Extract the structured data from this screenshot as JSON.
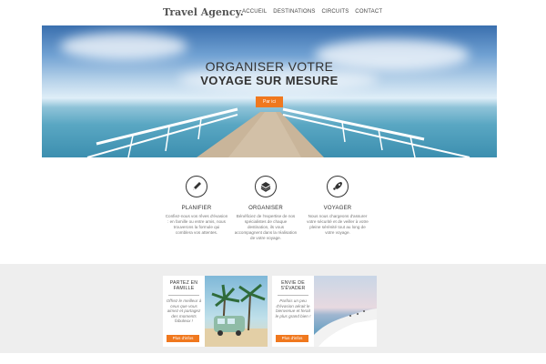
{
  "header": {
    "logo": "Travel Agency.",
    "menu": [
      "ACCUEIL",
      "DESTINATIONS",
      "CIRCUITS",
      "CONTACT"
    ]
  },
  "hero": {
    "title_line1": "ORGANISER VOTRE",
    "title_line2": "VOYAGE SUR MESURE",
    "button": "Par ici"
  },
  "features": [
    {
      "icon": "pencil-icon",
      "title": "PLANIFIER",
      "text": "Confiez-nous vos rêves d'évasion : en famille ou entre amis, nous trouverons la formule qui comblera vos attentes."
    },
    {
      "icon": "layers-icon",
      "title": "ORGANISER",
      "text": "Bénéficiez de l'expertise de nos spécialistes de chaque destination, ils vous accompagnent dans la réalisation de votre voyage."
    },
    {
      "icon": "rocket-icon",
      "title": "VOYAGER",
      "text": "Nous nous chargeons d'assurer votre sécurité et de veiller à votre pleine sérénité tout au long de votre voyage."
    }
  ],
  "cards": [
    {
      "title": "PARTEZ EN FAMILLE",
      "desc": "Offrez le meilleur à ceux que vous aimez et partagez des moments fabuleux !",
      "button": "Plus d'infos"
    },
    {
      "title": "ENVIE DE S'ÉVADER",
      "desc": "Parfois un peu d'évasion aérait le bienvenue et ferait le plus grand bien !",
      "button": "Plus d'infos"
    }
  ],
  "colors": {
    "accent": "#f0781e",
    "band": "#eeeeee"
  }
}
